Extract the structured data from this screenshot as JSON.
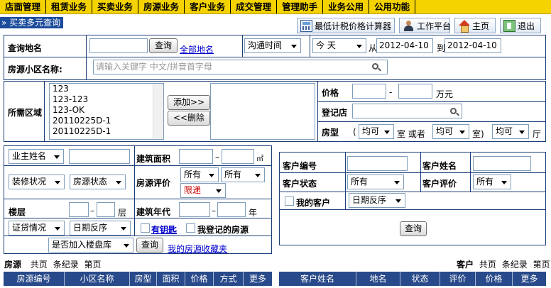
{
  "topnav": [
    "店面管理",
    "租赁业务",
    "买卖业务",
    "房源业务",
    "客户业务",
    "成交管理",
    "管理助手",
    "业务公用",
    "公用功能"
  ],
  "breadcrumb": "» 买卖多元查询",
  "toolbar": {
    "calc": "最低计税价格计算器",
    "workbench": "工作平台",
    "home": "主页",
    "exit": "退出"
  },
  "query": {
    "address_label": "查询地名",
    "query_button": "查询",
    "all_addresses_link": "全部地名",
    "contact_time": "沟通时间",
    "date_preset": "今  天",
    "from_label": "从",
    "from_date": "2012-04-10",
    "to_label": "到",
    "to_date": "2012-04-10",
    "community_label": "房源小区名称:",
    "community_placeholder": "请输入关键字 中文/拼音首字母"
  },
  "area": {
    "label": "所需区域",
    "options": [
      "123",
      "123-123",
      "123-OK",
      "20110225D-1",
      "20110225D-1"
    ],
    "add_button": "添加>>",
    "delete_button": "<<删除",
    "price_label": "价格",
    "price_dash": "-",
    "price_unit": "万元",
    "store_label": "登记店",
    "type_label": "房型",
    "type_paren_open": "(",
    "room_select": "均可",
    "room_unit": "室 或者",
    "room_select2": "均可",
    "room_close": "室)",
    "hall_select": "均可",
    "hall_unit": "厅"
  },
  "owner": {
    "owner_select": "业主姓名",
    "area_label": "建筑面积",
    "area_dash": "–",
    "area_unit": "㎡",
    "decor_select": "装修状况",
    "status_select": "房源状态",
    "rating_label": "房源评价",
    "rating_select1": "所有",
    "rating_select2": "所有",
    "rating_select3": "限递",
    "floor_label": "楼层",
    "floor_dash": "–",
    "floor_unit": "层",
    "year_label": "建筑年代",
    "year_dash": "–",
    "year_unit": "年",
    "loan_select": "证贷情况",
    "date_order_select": "日期反序",
    "has_key_link": "有钥匙",
    "my_listing_label": "我登记的房源",
    "add_to_pool_select": "是否加入楼盘库",
    "query_button": "查询",
    "favorites_link": "我的房源收藏夹"
  },
  "customer": {
    "id_label": "客户编号",
    "name_label": "客户姓名",
    "status_label": "客户状态",
    "status_select": "所有",
    "rating_label": "客户评价",
    "rating_select": "所有",
    "my_customer_label": "我的客户",
    "date_order_select": "日期反序",
    "query_button": "查询"
  },
  "listings_summary": {
    "title": "房源",
    "total_pages": "共页",
    "records": "条纪录",
    "page": "第页"
  },
  "customers_summary": {
    "title": "客户",
    "total_pages": "共页",
    "records": "条纪录",
    "page": "第页"
  },
  "listings_table": {
    "columns": [
      "房源编号",
      "小区名称",
      "房型",
      "面积",
      "价格",
      "方式",
      "更多"
    ]
  },
  "customers_table": {
    "columns": [
      "客户姓名",
      "地名",
      "状态",
      "评价",
      "价格",
      "更多"
    ]
  }
}
